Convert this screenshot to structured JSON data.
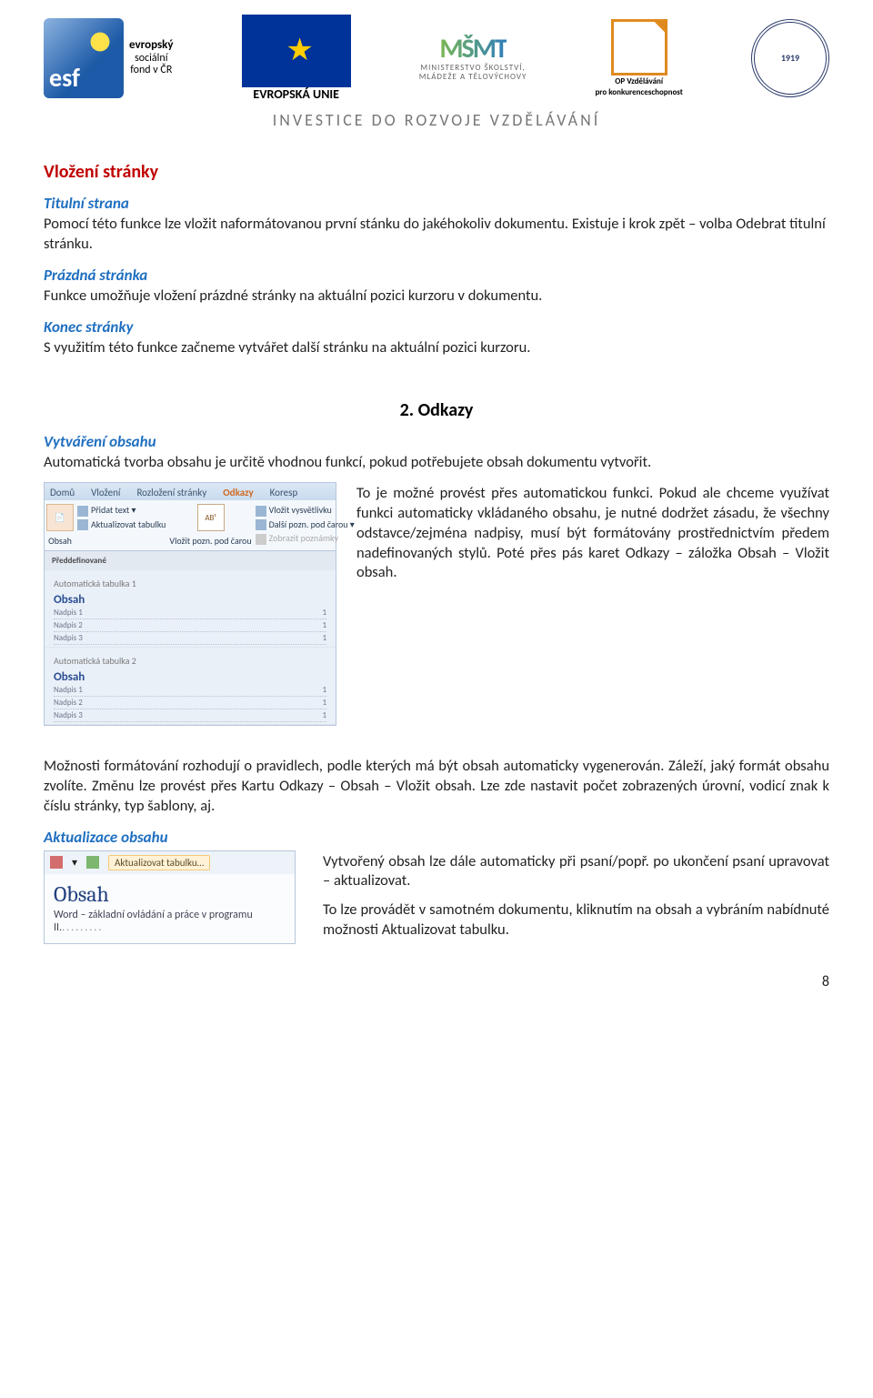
{
  "header": {
    "esf_label_top": "evropský",
    "esf_label_mid": "sociální",
    "esf_label_bot": "fond v ČR",
    "eu_caption": "EVROPSKÁ UNIE",
    "msmt_line1": "MINISTERSTVO ŠKOLSTVÍ,",
    "msmt_line2": "MLÁDEŽE A TĚLOVÝCHOVY",
    "op_line1": "OP Vzdělávání",
    "op_line2": "pro konkurenceschopnost",
    "gear_year": "1919",
    "tagline": "INVESTICE DO ROZVOJE VZDĚLÁVÁNÍ"
  },
  "s1": {
    "title": "Vložení stránky",
    "h_titulni": "Titulní strana",
    "p_titulni": "Pomocí této funkce lze vložit naformátovanou první stánku do jakéhokoliv dokumentu. Existuje i krok zpět – volba Odebrat titulní stránku.",
    "h_prazdna": "Prázdná stránka",
    "p_prazdna": "Funkce umožňuje vložení prázdné stránky na aktuální pozici kurzoru v dokumentu.",
    "h_konec": "Konec stránky",
    "p_konec": "S využitím této funkce začneme vytvářet další stránku na aktuální pozici kurzoru."
  },
  "s2": {
    "heading": "2. Odkazy",
    "h_vyt": "Vytváření obsahu",
    "p_vyt": "Automatická tvorba obsahu je určitě vhodnou funkcí, pokud potřebujete obsah dokumentu vytvořit.",
    "p_side": "To je možné provést přes automatickou funkci. Pokud ale chceme využívat funkci automaticky vkládaného obsahu, je nutné dodržet zásadu, že všechny odstavce/zejména nadpisy, musí být formátovány prostřednictvím předem nadefinovaných stylů. Poté přes pás karet Odkazy – záložka Obsah – Vložit obsah.",
    "ribbon": {
      "tabs": [
        "Domů",
        "Vložení",
        "Rozložení stránky",
        "Odkazy",
        "Koresp"
      ],
      "active_tab_index": 3,
      "col1": [
        "Obsah"
      ],
      "col2": [
        "Přidat text ▾",
        "Aktualizovat tabulku"
      ],
      "col3_big": "AB¹",
      "col3_caption": "Vložit pozn. pod čarou",
      "col4": [
        "Vložit vysvětlivku",
        "Další pozn. pod čarou ▾",
        "Zobrazit poznámky"
      ],
      "predef": "Předdefinované",
      "auto1": "Automatická tabulka 1",
      "auto2": "Automatická tabulka 2",
      "obsah_label": "Obsah",
      "rows": [
        [
          "Nadpis 1",
          "1"
        ],
        [
          "Nadpis 2",
          "1"
        ],
        [
          "Nadpis 3",
          "1"
        ]
      ]
    },
    "p_format": "Možnosti formátování rozhodují o pravidlech, podle kterých má být obsah automaticky vygenerován. Záleží, jaký formát obsahu zvolíte. Změnu lze provést přes Kartu Odkazy – Obsah – Vložit obsah. Lze zde nastavit počet zobrazených úrovní, vodicí znak k číslu stránky, typ šablony, aj.",
    "h_akt": "Aktualizace obsahu",
    "mini": {
      "btn": "Aktualizovat tabulku…",
      "title": "Obsah",
      "line": "Word – základní ovládání a práce v programu II."
    },
    "p_akt1": "Vytvořený obsah lze dále automaticky při psaní/popř. po ukončení psaní upravovat – aktualizovat.",
    "p_akt2": "To lze provádět v samotném dokumentu, kliknutím na obsah a vybráním nabídnuté možnosti Aktualizovat tabulku."
  },
  "page_number": "8"
}
